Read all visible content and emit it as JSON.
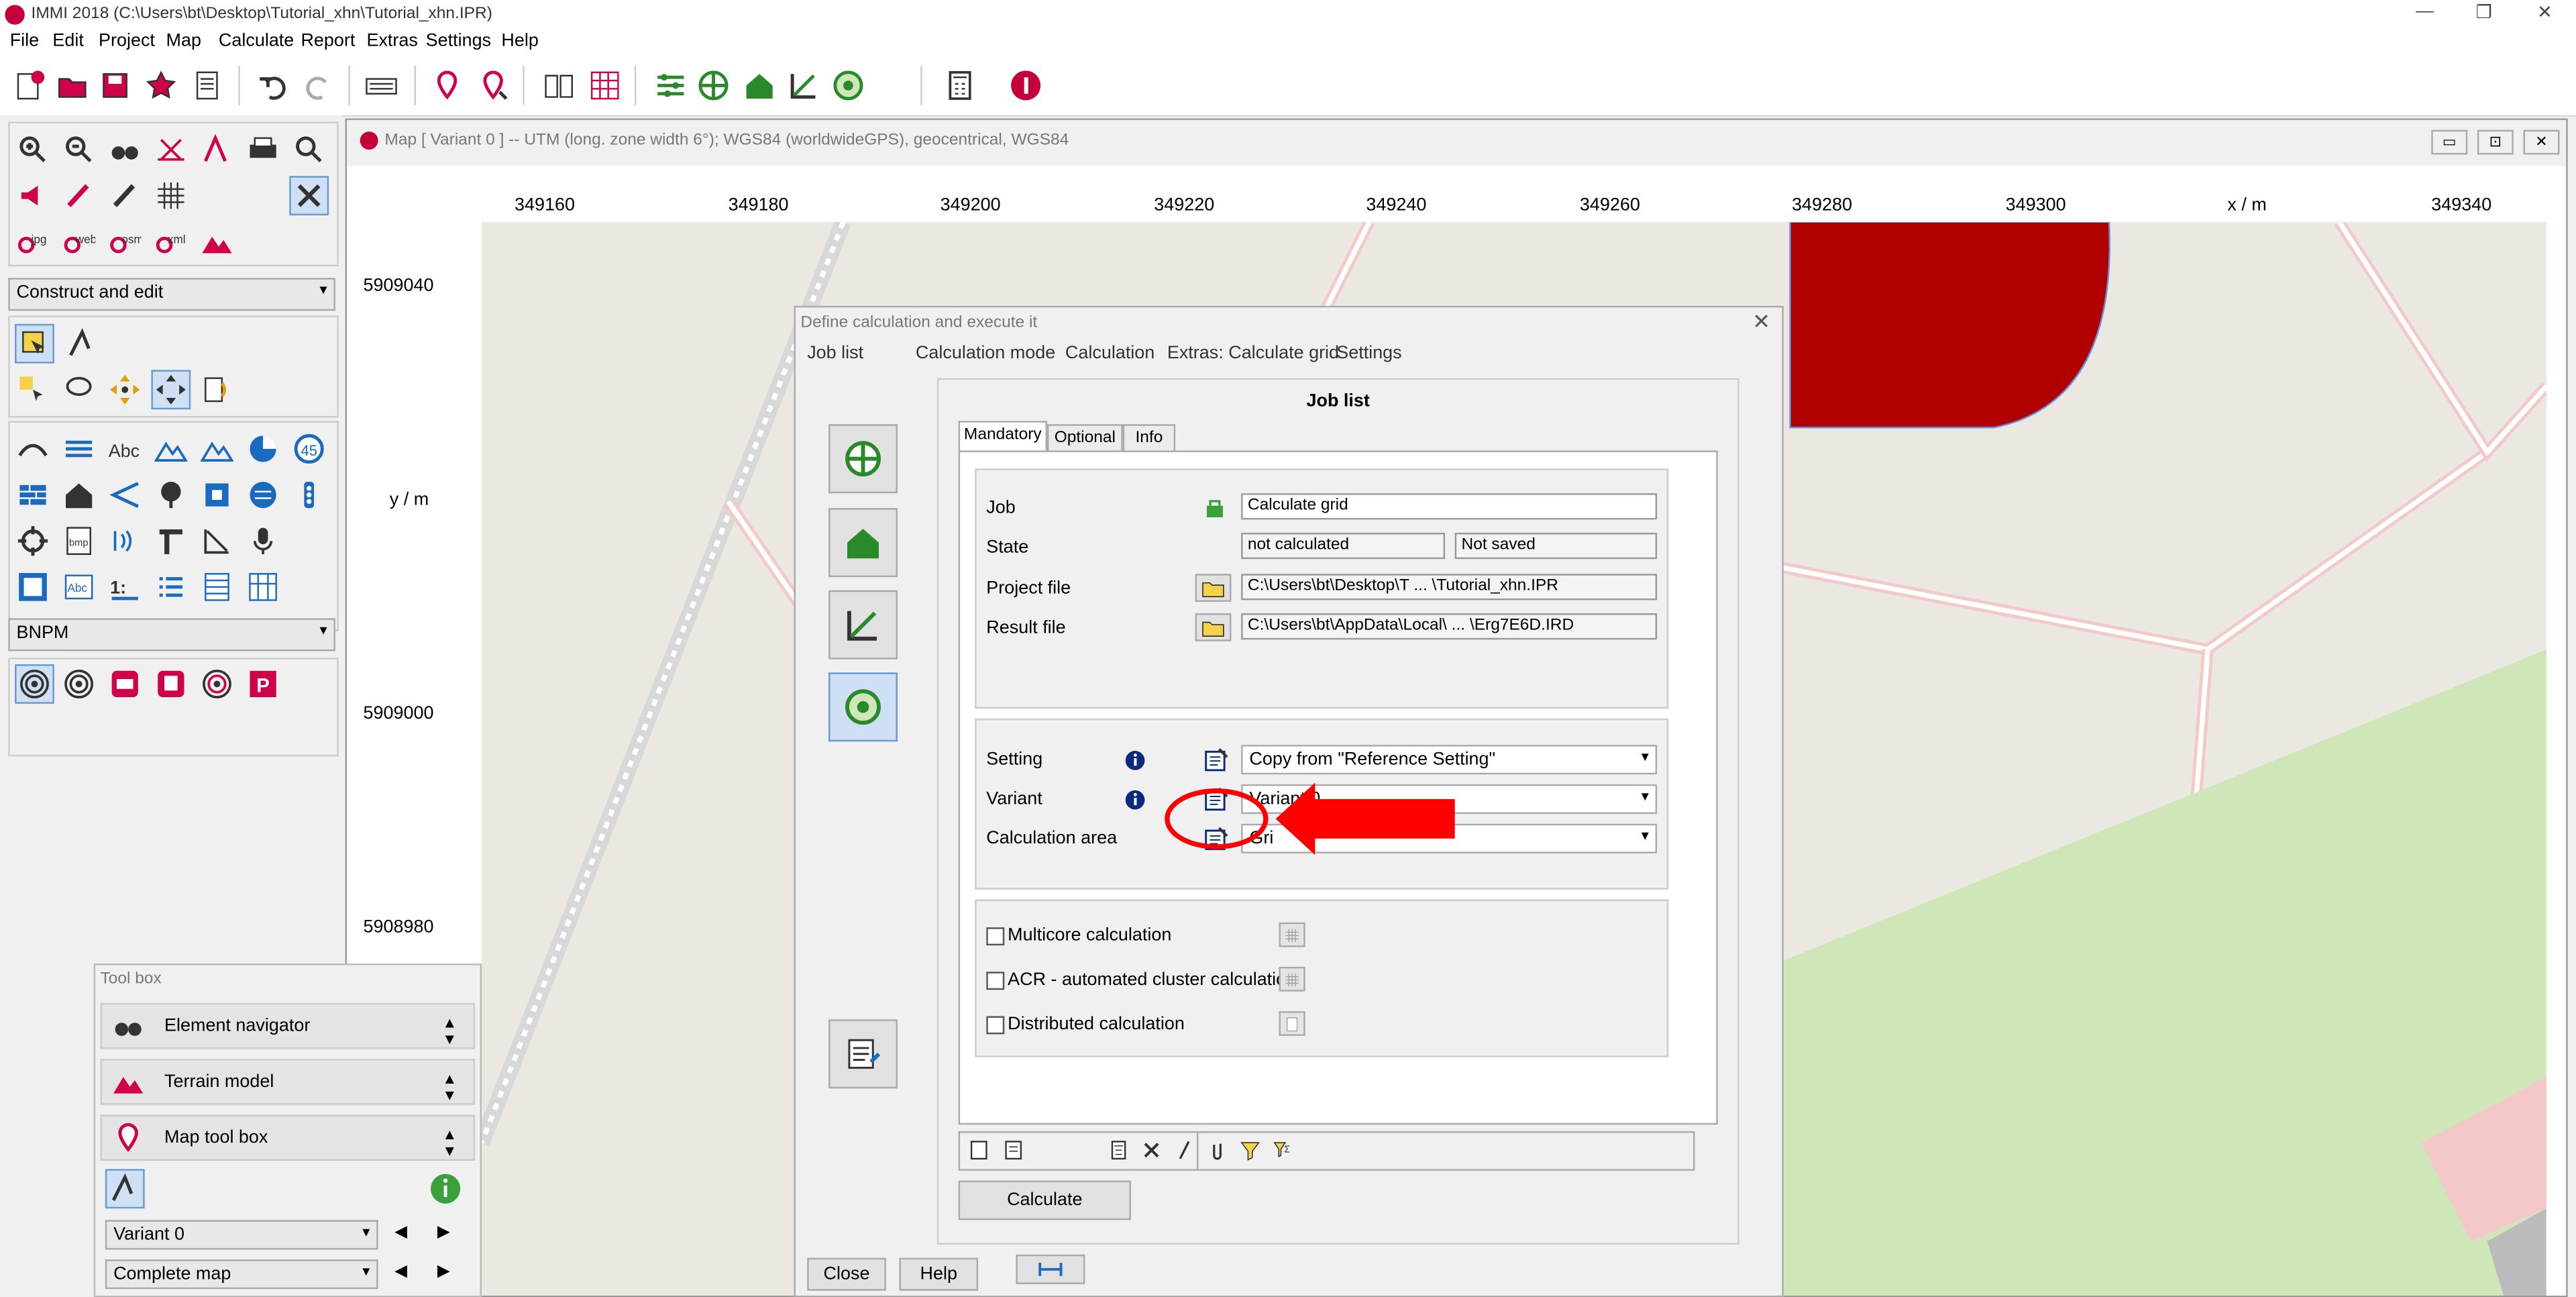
{
  "window": {
    "title": "IMMI 2018 (C:\\Users\\bt\\Desktop\\Tutorial_xhn\\Tutorial_xhn.IPR)",
    "minimize": "—",
    "maximize": "❐",
    "close": "✕"
  },
  "menu": [
    "File",
    "Edit",
    "Project",
    "Map",
    "Calculate",
    "Report",
    "Extras",
    "Settings",
    "Help"
  ],
  "left_panel": {
    "mode_select": "Construct and edit",
    "layer_select": "BNPM"
  },
  "map": {
    "title": "Map  [ Variant 0 ]  --  UTM (long. zone width 6°); WGS84 (worldwideGPS), geocentrical, WGS84",
    "x_ticks": [
      "349160",
      "349180",
      "349200",
      "349220",
      "349240",
      "349260",
      "349280",
      "349300",
      "x / m",
      "349340"
    ],
    "y_ticks": [
      "5909040",
      "y / m",
      "5909000",
      "5908980"
    ]
  },
  "dialog": {
    "title": "Define calculation and execute it",
    "menu": [
      "Job list",
      "Calculation mode",
      "Calculation",
      "Extras: Calculate grid",
      "Settings"
    ],
    "heading": "Job list",
    "tabs": [
      "Mandatory",
      "Optional",
      "Info"
    ],
    "job_label": "Job",
    "job_value": "Calculate grid",
    "state_label": "State",
    "state_value": "not calculated",
    "save_state": "Not saved",
    "project_file_label": "Project file",
    "project_file_value": "C:\\Users\\bt\\Desktop\\T ... \\Tutorial_xhn.IPR",
    "result_file_label": "Result file",
    "result_file_value": "C:\\Users\\bt\\AppData\\Local\\ ... \\Erg7E6D.IRD",
    "setting_label": "Setting",
    "setting_value": "Copy from \"Reference Setting\"",
    "variant_label": "Variant",
    "variant_value": "Variant 0",
    "calc_area_label": "Calculation area",
    "calc_area_value": "Gri",
    "multicore_label": "Multicore calculation",
    "acr_label": "ACR - automated cluster calculation",
    "distributed_label": "Distributed calculation",
    "calculate_button": "Calculate",
    "close_button": "Close",
    "help_button": "Help"
  },
  "toolbox": {
    "title": "Tool box",
    "items": [
      "Element navigator",
      "Terrain model",
      "Map tool box"
    ],
    "variant_select": "Variant 0",
    "view_select": "Complete map"
  },
  "colors": {
    "brand": "#c4003a",
    "highlight": "#ff0000",
    "building": "#b00000",
    "green_area": "#cfe6b8"
  }
}
